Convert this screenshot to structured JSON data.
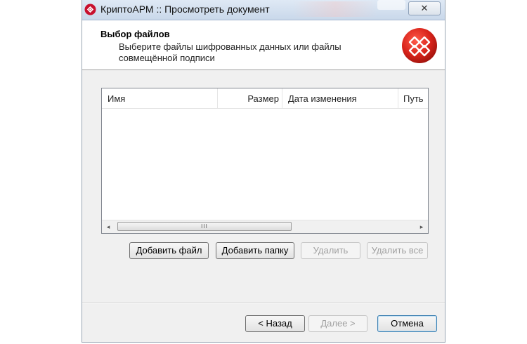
{
  "window": {
    "title": "КриптоАРМ :: Просмотреть документ",
    "close_glyph": "✕"
  },
  "header": {
    "title": "Выбор файлов",
    "subtitle": "Выберите файлы шифрованных данных или файлы совмещённой подписи",
    "logo_icon": "cryptoarm-logo-icon"
  },
  "file_list": {
    "columns": [
      "Имя",
      "Размер",
      "Дата изменения",
      "Путь"
    ],
    "rows": [],
    "scrollbar": {
      "left_arrow": "◂",
      "right_arrow": "▸",
      "grip": "III"
    }
  },
  "actions": {
    "add_file": "Добавить файл",
    "add_folder": "Добавить папку",
    "remove": "Удалить",
    "remove_all": "Удалить все"
  },
  "navigation": {
    "back": "< Назад",
    "next": "Далее >",
    "cancel": "Отмена"
  },
  "colors": {
    "accent": "#c8102e",
    "window_bg": "#f0f0f0",
    "titlebar": "#c9d8ea"
  }
}
